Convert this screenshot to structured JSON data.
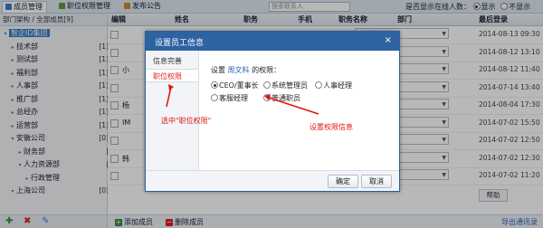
{
  "topbar": {
    "tabs": [
      {
        "label": "成员管理",
        "icon_color": "#3a7fc4"
      },
      {
        "label": "职位权限管理",
        "icon_color": "#5a9a3a"
      },
      {
        "label": "发布公告",
        "icon_color": "#c88a2a"
      }
    ],
    "search_placeholder": "搜索联系人",
    "online_question": "是否显示在线人数：",
    "online_options": [
      "显示",
      "不显示"
    ]
  },
  "sidebar": {
    "header": "部门架构 / 全部成员[9]",
    "items": [
      {
        "label": "智企ID集团",
        "count": "",
        "expand": "▾",
        "indent": 0,
        "selected": true
      },
      {
        "label": "技术部",
        "count": "[1]",
        "expand": "▸",
        "indent": 1
      },
      {
        "label": "测试部",
        "count": "[1]",
        "expand": "▸",
        "indent": 1
      },
      {
        "label": "福利部",
        "count": "[1]",
        "expand": "▸",
        "indent": 1
      },
      {
        "label": "人事部",
        "count": "[1]",
        "expand": "▸",
        "indent": 1
      },
      {
        "label": "推广部",
        "count": "[1]",
        "expand": "▸",
        "indent": 1
      },
      {
        "label": "总经办",
        "count": "[1]",
        "expand": "▸",
        "indent": 1
      },
      {
        "label": "运营部",
        "count": "[1]",
        "expand": "▸",
        "indent": 1
      },
      {
        "label": "安徽公司",
        "count": "[0]",
        "expand": "▾",
        "indent": 1
      },
      {
        "label": "财务部",
        "count": "[1]",
        "expand": "▸",
        "indent": 2
      },
      {
        "label": "人力资源部",
        "count": "[1]",
        "expand": "▾",
        "indent": 2
      },
      {
        "label": "行政管理",
        "count": "[0]",
        "expand": "▸",
        "indent": 3
      },
      {
        "label": "上海公司",
        "count": "[0]",
        "expand": "▾",
        "indent": 1
      }
    ],
    "footer_icons": [
      "add-icon",
      "delete-icon",
      "edit-icon"
    ]
  },
  "table": {
    "headers": [
      "编辑",
      "姓名",
      "职务",
      "手机",
      "职务名称",
      "部门",
      "最后登录"
    ],
    "rows": [
      {
        "name": "",
        "dept": "|__总经办",
        "date": "2014-08-13 09:30"
      },
      {
        "name": "",
        "dept": "智企ID集团",
        "date": "2014-08-12 13:10"
      },
      {
        "name": "小",
        "dept": "|__人事部",
        "date": "2014-08-12 11:40"
      },
      {
        "name": "",
        "dept": "|__运营部",
        "date": "2014-07-14 13:40"
      },
      {
        "name": "杨",
        "dept": "|__推广部",
        "date": "2014-08-04 17:30"
      },
      {
        "name": "IM",
        "dept": "|__技术部",
        "date": "2014-07-02 15:50"
      },
      {
        "name": "",
        "dept": "|__运营部",
        "date": "2014-07-02 12:50"
      },
      {
        "name": "韩",
        "dept": "|__总经办",
        "date": "2014-07-02 12:30"
      },
      {
        "name": "",
        "dept": "|__福利部",
        "date": "2014-07-02 11:20"
      }
    ],
    "help_label": "帮助",
    "footer": {
      "add_label": "添加成员",
      "delete_label": "删除成员",
      "export_label": "导出通讯录"
    }
  },
  "modal": {
    "title": "设置员工信息",
    "close_glyph": "×",
    "tabs": [
      {
        "label": "信息完善",
        "active": false
      },
      {
        "label": "职位权限",
        "active": true
      }
    ],
    "prompt_prefix": "设置",
    "employee_name": "周文科",
    "prompt_suffix": "的权限：",
    "roles": [
      {
        "label": "CEO/董事长",
        "selected": true
      },
      {
        "label": "系统管理员",
        "selected": false
      },
      {
        "label": "人事经理",
        "selected": false
      },
      {
        "label": "客服经理",
        "selected": false
      },
      {
        "label": "普通职员",
        "selected": false
      }
    ],
    "confirm_label": "确定",
    "cancel_label": "取消"
  },
  "annotations": {
    "select_tab": "选中\"职位权限\"",
    "set_permission": "设置权限信息",
    "color": "#e21616"
  }
}
